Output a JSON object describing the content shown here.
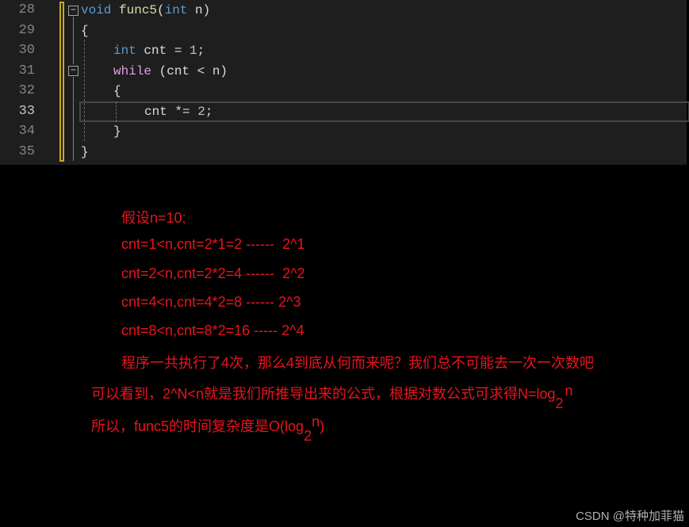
{
  "editor": {
    "line_numbers": [
      "28",
      "29",
      "30",
      "31",
      "32",
      "33",
      "34",
      "35"
    ],
    "current_line": "33",
    "lines": [
      {
        "t1": "void",
        "t2": " ",
        "t3": "func5",
        "t4": "(",
        "t5": "int",
        "t6": " n)"
      },
      {
        "text": "{"
      },
      {
        "k": "int",
        "rest": " cnt = ",
        "n": "1",
        ";": ";"
      },
      {
        "k": "while",
        "rest": " (cnt < n)"
      },
      {
        "text": "{"
      },
      {
        "rest": "cnt *= ",
        "n": "2",
        ";": ";"
      },
      {
        "text": "}"
      },
      {
        "text": "}"
      }
    ]
  },
  "notes": {
    "l1": "假设n=10;",
    "l2": "cnt=1<n,cnt=2*1=2 ------  2^1",
    "l3": "cnt=2<n,cnt=2*2=4 ------  2^2",
    "l4": "cnt=4<n,cnt=4*2=8 ------ 2^3",
    "l5": "cnt=8<n,cnt=8*2=16 ----- 2^4",
    "l6": "程序一共执行了4次，那么4到底从何而来呢？我们总不可能去一次一次数吧",
    "l7": "可以看到，2^N<n就是我们所推导出来的公式，根据对数公式可求得N=log",
    "l7_sub": "2",
    "l7_sup": "n",
    "l8": "所以，func5的时间复杂度是O(log",
    "l8_sub": "2",
    "l8_sup": "n",
    "l8_end": ")"
  },
  "watermark": "CSDN @特种加菲猫",
  "colors": {
    "text": "#e8141e",
    "editor_bg": "#1e1e1e",
    "keyword": "#569cd6"
  }
}
